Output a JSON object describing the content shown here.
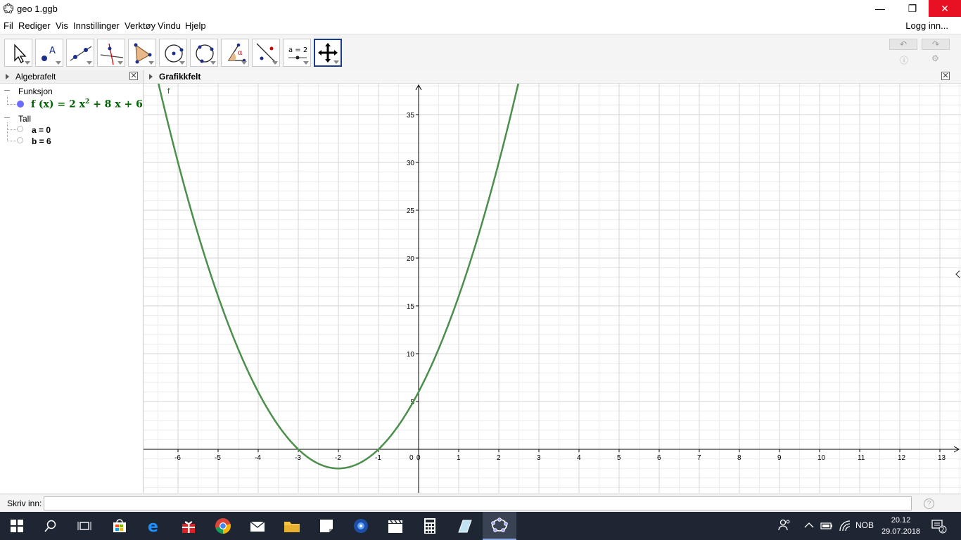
{
  "window": {
    "title": "geo 1.ggb"
  },
  "menu": [
    "Fil",
    "Rediger",
    "Vis",
    "Innstillinger",
    "Verktøy",
    "Vindu",
    "Hjelp"
  ],
  "login_label": "Logg inn...",
  "toolbar": {
    "tools": [
      "move",
      "point",
      "line",
      "perpendicular-line",
      "polygon",
      "circle",
      "circle-through-points",
      "angle",
      "reflect",
      "slider",
      "move-graphics-view"
    ],
    "slider_text": "a = 2",
    "angle_glyph": "α"
  },
  "algebra": {
    "header": "Algebrafelt",
    "categories": [
      {
        "label": "Funksjon"
      },
      {
        "label": "Tall"
      }
    ],
    "function": {
      "name": "f(x)",
      "expr_prefix": "f (x)  =  2 x",
      "exponent": "2",
      "expr_suffix": " + 8 x + 6"
    },
    "numbers": [
      "a = 0",
      "b = 6"
    ]
  },
  "graphics": {
    "header": "Grafikkfelt",
    "curve_label": "f",
    "axis_color": "#000000",
    "curve_color": "#4a8f4a"
  },
  "chart_data": {
    "type": "line",
    "title": "",
    "xlabel": "",
    "ylabel": "",
    "xlim": [
      -6.9,
      13.5
    ],
    "ylim": [
      -4.5,
      38
    ],
    "x_ticks": [
      -6,
      -5,
      -4,
      -3,
      -2,
      -1,
      0,
      1,
      2,
      3,
      4,
      5,
      6,
      7,
      8,
      9,
      10,
      11,
      12,
      13
    ],
    "y_ticks": [
      5,
      10,
      15,
      20,
      25,
      30,
      35
    ],
    "series": [
      {
        "name": "f",
        "function": {
          "a": 2,
          "b": 8,
          "c": 6
        }
      }
    ],
    "grid": true
  },
  "inputbar": {
    "label": "Skriv inn:",
    "value": ""
  },
  "taskbar": {
    "clock_time": "20.12",
    "clock_date": "29.07.2018",
    "language": "NOB",
    "notifications": "2"
  }
}
